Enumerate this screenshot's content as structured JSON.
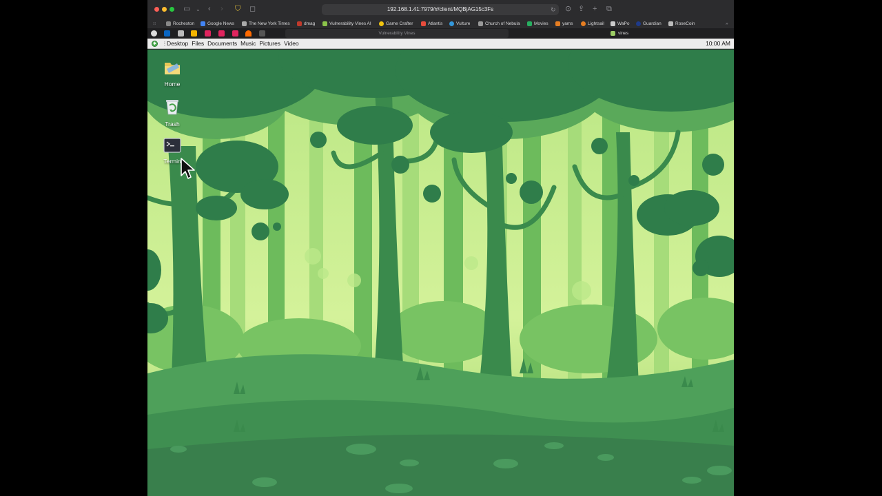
{
  "browser": {
    "url": "192.168.1.41:7979/#/client/MQBjAG15c3Fs",
    "bookmarks": [
      {
        "label": "Rocheston",
        "color": "#888"
      },
      {
        "label": "Google News",
        "color": "#4285f4"
      },
      {
        "label": "The New York Times",
        "color": "#aaa"
      },
      {
        "label": "dmag",
        "color": "#c0392b"
      },
      {
        "label": "Vulnerability Vines AI",
        "color": "#8bc34a"
      },
      {
        "label": "Game Crafter",
        "color": "#f1c40f"
      },
      {
        "label": "Atlantis",
        "color": "#e74c3c"
      },
      {
        "label": "Vulture",
        "color": "#3498db"
      },
      {
        "label": "Church of Nebula",
        "color": "#999"
      },
      {
        "label": "Movies",
        "color": "#27ae60"
      },
      {
        "label": "yams",
        "color": "#e67e22"
      },
      {
        "label": "Lightsail",
        "color": "#e67e22"
      },
      {
        "label": "WaPo",
        "color": "#ccc"
      },
      {
        "label": "Guardian",
        "color": "#1e3a8a"
      },
      {
        "label": "RoseCoin",
        "color": "#bbb"
      }
    ],
    "active_tab": "Vulnerability Vines",
    "second_tab": "vines"
  },
  "desktop": {
    "panel_menu": [
      "Desktop",
      "Files",
      "Documents",
      "Music",
      "Pictures",
      "Video"
    ],
    "clock": "10:00 AM",
    "icons": [
      {
        "label": "Home",
        "icon": "folder-icon"
      },
      {
        "label": "Trash",
        "icon": "trash-icon"
      },
      {
        "label": "Termin",
        "icon": "terminal-icon"
      }
    ]
  },
  "colors": {
    "forest_dark": "#2f7d4a",
    "forest_mid": "#4a9d55",
    "forest_light": "#a8de7a",
    "sky": "#c8ee8e"
  }
}
